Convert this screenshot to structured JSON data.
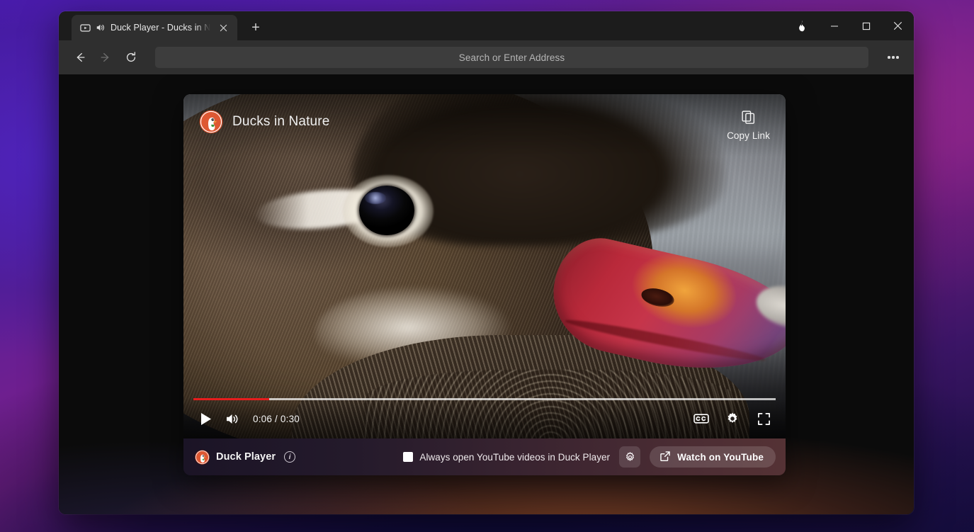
{
  "browser": {
    "tab": {
      "title": "Duck Player - Ducks in Nature",
      "player_icon": "video-player-icon",
      "audio_icon": "speaker-playing-icon",
      "close_icon": "close-icon"
    },
    "new_tab_label": "+",
    "window_controls": {
      "fire_label": "fire-button-icon",
      "minimize_label": "minimize-icon",
      "maximize_label": "maximize-icon",
      "close_label": "close-icon"
    },
    "nav": {
      "back": "back-arrow-icon",
      "forward": "forward-arrow-icon",
      "reload": "reload-icon",
      "more": "more-options-icon"
    },
    "omnibox": {
      "value": "",
      "placeholder": "Search or Enter Address"
    }
  },
  "player": {
    "video_title": "Ducks in Nature",
    "copy_link_label": "Copy Link",
    "copy_icon": "copy-icon",
    "logo_icon": "duckduckgo-logo-icon",
    "controls": {
      "play_icon": "play-icon",
      "volume_icon": "volume-icon",
      "time_display": "0:06 / 0:30",
      "current_time": "0:06",
      "duration": "0:30",
      "progress_percent": 13,
      "captions_label": "CC",
      "settings_icon": "gear-icon",
      "fullscreen_icon": "fullscreen-icon"
    }
  },
  "bottom_bar": {
    "brand_name": "Duck Player",
    "info_icon": "info-icon",
    "info_glyph": "i",
    "checkbox": {
      "label": "Always open YouTube videos in Duck Player",
      "checked": false
    },
    "settings_icon": "gear-icon",
    "watch_button": {
      "label": "Watch on YouTube",
      "icon": "external-link-icon"
    }
  },
  "colors": {
    "accent_red": "#e61d1d",
    "duck_orange": "#de5833",
    "tab_active": "#2f2f2f",
    "toolbar": "#2f2f2f"
  }
}
